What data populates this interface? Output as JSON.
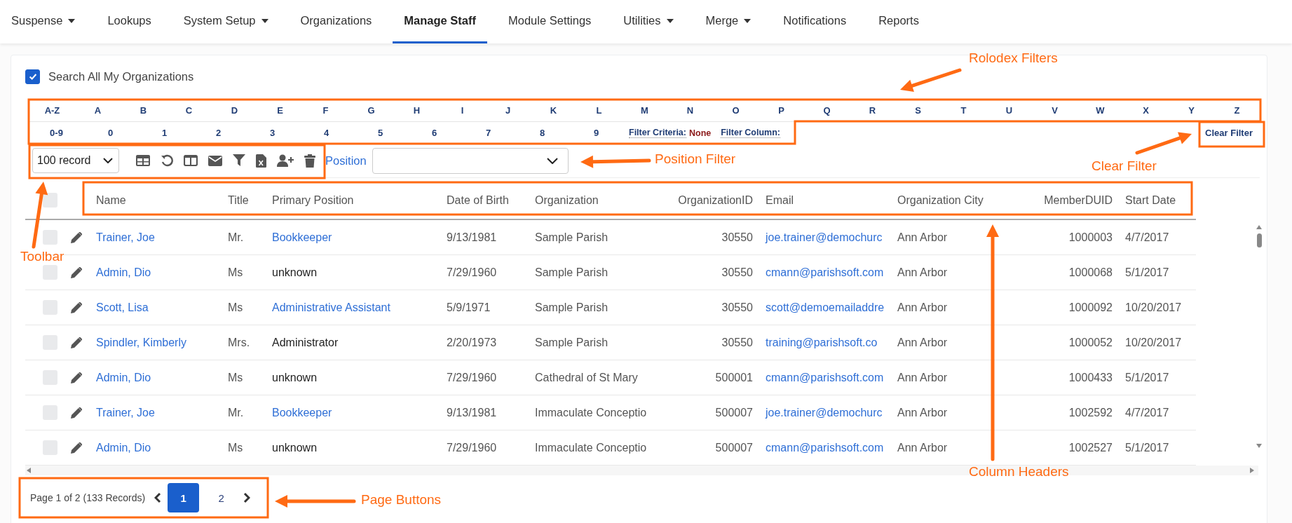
{
  "nav": [
    {
      "label": "Suspense",
      "dropdown": true,
      "selected": false
    },
    {
      "label": "Lookups",
      "dropdown": false,
      "selected": false
    },
    {
      "label": "System Setup",
      "dropdown": true,
      "selected": false
    },
    {
      "label": "Organizations",
      "dropdown": false,
      "selected": false
    },
    {
      "label": "Manage Staff",
      "dropdown": false,
      "selected": true
    },
    {
      "label": "Module Settings",
      "dropdown": false,
      "selected": false
    },
    {
      "label": "Utilities",
      "dropdown": true,
      "selected": false
    },
    {
      "label": "Merge",
      "dropdown": true,
      "selected": false
    },
    {
      "label": "Notifications",
      "dropdown": false,
      "selected": false
    },
    {
      "label": "Reports",
      "dropdown": false,
      "selected": false
    }
  ],
  "search_all": {
    "label": "Search All My Organizations",
    "checked": true
  },
  "rolodex": {
    "letters": [
      "A-Z",
      "A",
      "B",
      "C",
      "D",
      "E",
      "F",
      "G",
      "H",
      "I",
      "J",
      "K",
      "L",
      "M",
      "N",
      "O",
      "P",
      "Q",
      "R",
      "S",
      "T",
      "U",
      "V",
      "W",
      "X",
      "Y",
      "Z"
    ],
    "digits": [
      "0-9",
      "0",
      "1",
      "2",
      "3",
      "4",
      "5",
      "6",
      "7",
      "8",
      "9"
    ],
    "filter_criteria_label": "Filter Criteria:",
    "filter_criteria_value": "None",
    "filter_column_label": "Filter Column:",
    "clear_filter": "Clear Filter"
  },
  "toolbar": {
    "page_size": "100 record",
    "position_label": "Position"
  },
  "table": {
    "select_all_checked": false,
    "columns": [
      "Name",
      "Title",
      "Primary Position",
      "Date of Birth",
      "Organization",
      "OrganizationID",
      "Email",
      "Organization City",
      "MemberDUID",
      "Start Date"
    ],
    "rows": [
      {
        "checked": false,
        "name": "Trainer, Joe",
        "title": "Mr.",
        "position": "Bookkeeper",
        "position_linked": true,
        "dob": "9/13/1981",
        "organization": "Sample Parish",
        "organization_id": "30550",
        "email": "joe.trainer@demochurc",
        "city": "Ann Arbor",
        "member_duid": "1000003",
        "start_date": "4/7/2017"
      },
      {
        "checked": false,
        "name": "Admin, Dio",
        "title": "Ms",
        "position": "unknown",
        "position_linked": false,
        "dob": "7/29/1960",
        "organization": "Sample Parish",
        "organization_id": "30550",
        "email": "cmann@parishsoft.com",
        "city": "Ann Arbor",
        "member_duid": "1000068",
        "start_date": "5/1/2017"
      },
      {
        "checked": false,
        "name": "Scott, Lisa",
        "title": "Ms",
        "position": "Administrative Assistant",
        "position_linked": true,
        "dob": "5/9/1971",
        "organization": "Sample Parish",
        "organization_id": "30550",
        "email": "scott@demoemailaddre",
        "city": "Ann Arbor",
        "member_duid": "1000092",
        "start_date": "10/20/2017"
      },
      {
        "checked": false,
        "name": "Spindler, Kimberly",
        "title": "Mrs.",
        "position": "Administrator",
        "position_linked": false,
        "dob": "2/20/1973",
        "organization": "Sample Parish",
        "organization_id": "30550",
        "email": "training@parishsoft.co",
        "city": "Ann Arbor",
        "member_duid": "1000052",
        "start_date": "10/20/2017"
      },
      {
        "checked": false,
        "name": "Admin, Dio",
        "title": "Ms",
        "position": "unknown",
        "position_linked": false,
        "dob": "7/29/1960",
        "organization": "Cathedral of St Mary",
        "organization_id": "500001",
        "email": "cmann@parishsoft.com",
        "city": "Ann Arbor",
        "member_duid": "1000433",
        "start_date": "5/1/2017"
      },
      {
        "checked": false,
        "name": "Trainer, Joe",
        "title": "Mr.",
        "position": "Bookkeeper",
        "position_linked": true,
        "dob": "9/13/1981",
        "organization": "Immaculate Conceptio",
        "organization_id": "500007",
        "email": "joe.trainer@demochurc",
        "city": "Ann Arbor",
        "member_duid": "1002592",
        "start_date": "4/7/2017"
      },
      {
        "checked": false,
        "name": "Admin, Dio",
        "title": "Ms",
        "position": "unknown",
        "position_linked": false,
        "dob": "7/29/1960",
        "organization": "Immaculate Conceptio",
        "organization_id": "500007",
        "email": "cmann@parishsoft.com",
        "city": "Ann Arbor",
        "member_duid": "1002527",
        "start_date": "5/1/2017"
      }
    ]
  },
  "pagination": {
    "summary": "Page 1 of 2 (133 Records)",
    "pages": [
      {
        "label": "1",
        "selected": true
      },
      {
        "label": "2",
        "selected": false
      }
    ]
  },
  "annotations": [
    {
      "label": "Rolodex Filters"
    },
    {
      "label": "Position Filter"
    },
    {
      "label": "Clear Filter"
    },
    {
      "label": "Toolbar"
    },
    {
      "label": "Column Headers"
    },
    {
      "label": "Page Buttons"
    }
  ]
}
